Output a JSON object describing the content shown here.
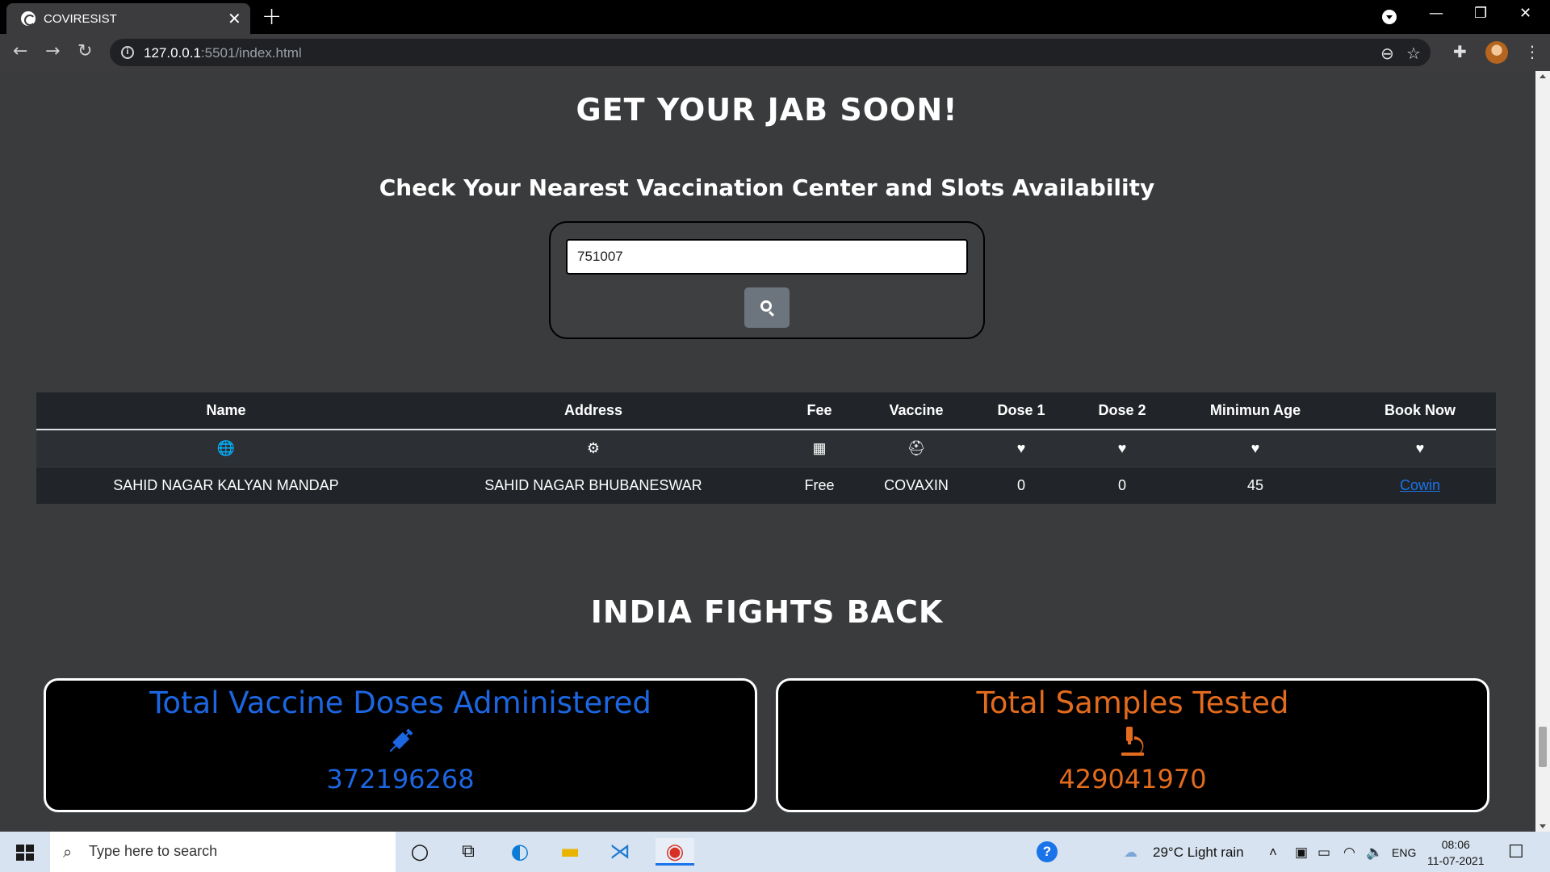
{
  "browser": {
    "tab_title": "COVIRESIST",
    "url_host": "127.0.0.1",
    "url_rest": ":5501/index.html"
  },
  "page": {
    "jab_heading": "GET YOUR JAB SOON!",
    "check_heading": "Check Your Nearest Vaccination Center and Slots Availability",
    "pincode_value": "751007",
    "table": {
      "headers": [
        "Name",
        "Address",
        "Fee",
        "Vaccine",
        "Dose 1",
        "Dose 2",
        "Minimun Age",
        "Book Now"
      ],
      "icons": [
        "globe-icon",
        "gears-icon",
        "hospital-icon",
        "vaccine-hand-icon",
        "heart-icon",
        "heart-icon",
        "heart-icon",
        "heart-icon"
      ],
      "row": {
        "name": "SAHID NAGAR KALYAN MANDAP",
        "address": "SAHID NAGAR BHUBANESWAR",
        "fee": "Free",
        "vaccine": "COVAXIN",
        "dose1": "0",
        "dose2": "0",
        "min_age": "45",
        "book_link": "Cowin"
      }
    },
    "india_heading": "INDIA FIGHTS BACK",
    "stats": [
      {
        "title": "Total Vaccine Doses Administered",
        "icon": "syringe-icon",
        "value": "372196268",
        "color": "#1d66e2"
      },
      {
        "title": "Total Samples Tested",
        "icon": "microscope-icon",
        "value": "429041970",
        "color": "#e36b1e"
      }
    ]
  },
  "taskbar": {
    "search_placeholder": "Type here to search",
    "weather": "29°C  Light rain",
    "language": "ENG",
    "time": "08:06",
    "date": "11-07-2021"
  }
}
